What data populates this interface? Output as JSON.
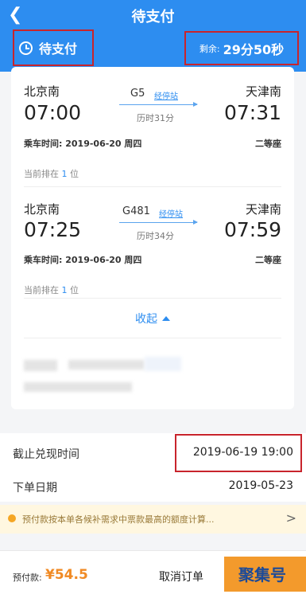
{
  "header": {
    "back_icon": "back-arrow",
    "title": "待支付",
    "status_icon": "clock-icon",
    "status": "待支付",
    "remain_label": "剩余:",
    "remain_value": "29分50秒"
  },
  "segments": [
    {
      "from": "北京南",
      "to": "天津南",
      "train": "G5",
      "stop_link": "经停站",
      "dep_time": "07:00",
      "arr_time": "07:31",
      "duration": "历时31分",
      "date": "乘车时间: 2019-06-20 周四",
      "seat": "二等座",
      "rank_prefix": "当前排在",
      "rank_num": "1",
      "rank_suffix": "位"
    },
    {
      "from": "北京南",
      "to": "天津南",
      "train": "G481",
      "stop_link": "经停站",
      "dep_time": "07:25",
      "arr_time": "07:59",
      "duration": "历时34分",
      "date": "乘车时间: 2019-06-20 周四",
      "seat": "二等座",
      "rank_prefix": "当前排在",
      "rank_num": "1",
      "rank_suffix": "位"
    }
  ],
  "collapse_label": "收起",
  "info": {
    "deadline_label": "截止兑现时间",
    "deadline_value": "2019-06-19 19:00",
    "order_date_label": "下单日期",
    "order_date_value": "2019-05-23"
  },
  "notice": {
    "text": "预付款按本单各候补需求中票款最高的额度计算...",
    "chevron": ">"
  },
  "bottom": {
    "prepay_label": "预付款:",
    "prepay_amount": "¥54.5",
    "cancel_label": "取消订单"
  },
  "watermark": "聚集号"
}
